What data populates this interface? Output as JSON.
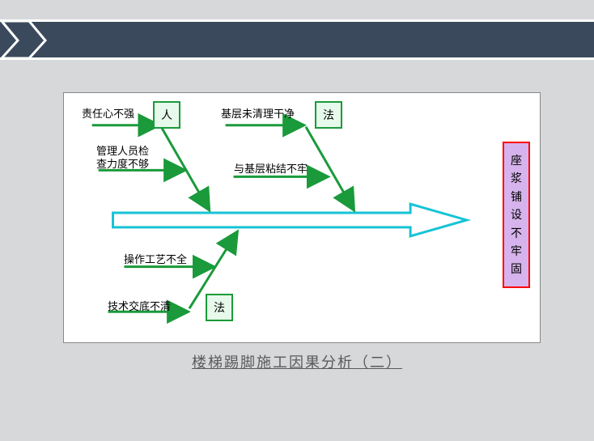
{
  "caption": "楼梯踢脚施工因果分析（二）",
  "effect": "座浆铺设不牢固",
  "categories": {
    "top_left": "人",
    "top_right": "法",
    "bottom": "法"
  },
  "causes": {
    "c1": "责任心不强",
    "c2_line1": "管理人员检",
    "c2_line2": "查力度不够",
    "c3": "基层未清理干净",
    "c4": "与基层粘结不牢",
    "c5": "操作工艺不全",
    "c6": "技术交底不清"
  },
  "chart_data": {
    "type": "fishbone",
    "title": "楼梯踢脚施工因果分析（二）",
    "effect": "座浆铺设不牢固",
    "bones": [
      {
        "category": "人",
        "causes": [
          "责任心不强",
          "管理人员检查力度不够"
        ]
      },
      {
        "category": "法",
        "causes": [
          "基层未清理干净",
          "与基层粘结不牢"
        ]
      },
      {
        "category": "法",
        "causes": [
          "操作工艺不全",
          "技术交底不清"
        ]
      }
    ]
  }
}
